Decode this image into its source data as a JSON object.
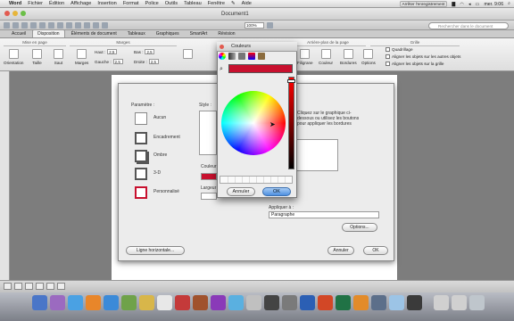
{
  "menubar": {
    "items": [
      "Word",
      "Fichier",
      "Édition",
      "Affichage",
      "Insertion",
      "Format",
      "Police",
      "Outils",
      "Tableau",
      "Fenêtre",
      "Aide"
    ],
    "record_label": "Arrêter l'enregistrement",
    "clock": "mer. 9:06"
  },
  "window": {
    "title": "Document1"
  },
  "toolbar": {
    "zoom": "100%",
    "search_placeholder": "Rechercher dans le document"
  },
  "ribbon": {
    "tabs": [
      "Accueil",
      "Disposition",
      "Éléments de document",
      "Tableaux",
      "Graphiques",
      "SmartArt",
      "Révision"
    ],
    "active_tab": "Disposition",
    "groups": {
      "page_setup": "Mise en page",
      "margins": "Marges",
      "background": "Arrière-plan de la page",
      "grid": "Grille"
    },
    "buttons": {
      "orientation": "Orientation",
      "size": "Taille",
      "break": "Saut",
      "margins": "Marges",
      "watermark": "Filigrane",
      "color": "Couleur",
      "borders": "Bordures",
      "options": "Options"
    },
    "margins": {
      "top_label": "Haut :",
      "top_value": "2,5",
      "bottom_label": "Bas :",
      "bottom_value": "2,5",
      "left_label": "Gauche :",
      "left_value": "2,5",
      "right_label": "Droite :",
      "right_value": "2,5"
    },
    "grid": {
      "grid_lines": "Quadrillage",
      "snap_objects": "Aligner les objets sur les autres objets",
      "snap_grid": "Aligner les objets sur la grille"
    }
  },
  "borders_dialog": {
    "settings_label": "Paramètre :",
    "settings": [
      "Aucun",
      "Encadrement",
      "Ombre",
      "3-D",
      "Personnalisé"
    ],
    "style_label": "Style :",
    "color_label": "Couleur",
    "width_label": "Largeur",
    "preview_text": "Cliquez sur le graphique ci-dessous ou utilisez les boutons pour appliquer les bordures",
    "apply_label": "Appliquer à :",
    "apply_value": "Paragraphe",
    "options_button": "Options...",
    "hline_button": "Ligne horizontale...",
    "cancel": "Annuler",
    "ok": "OK",
    "colors": {
      "selected": "#c8102e"
    }
  },
  "color_picker": {
    "title": "Couleurs",
    "cancel": "Annuler",
    "ok": "OK",
    "selected_color": "#c8102e"
  },
  "colors": {
    "accent": "#4d8fe0",
    "desktop": "#7d7d7d",
    "selected": "#c8102e"
  }
}
